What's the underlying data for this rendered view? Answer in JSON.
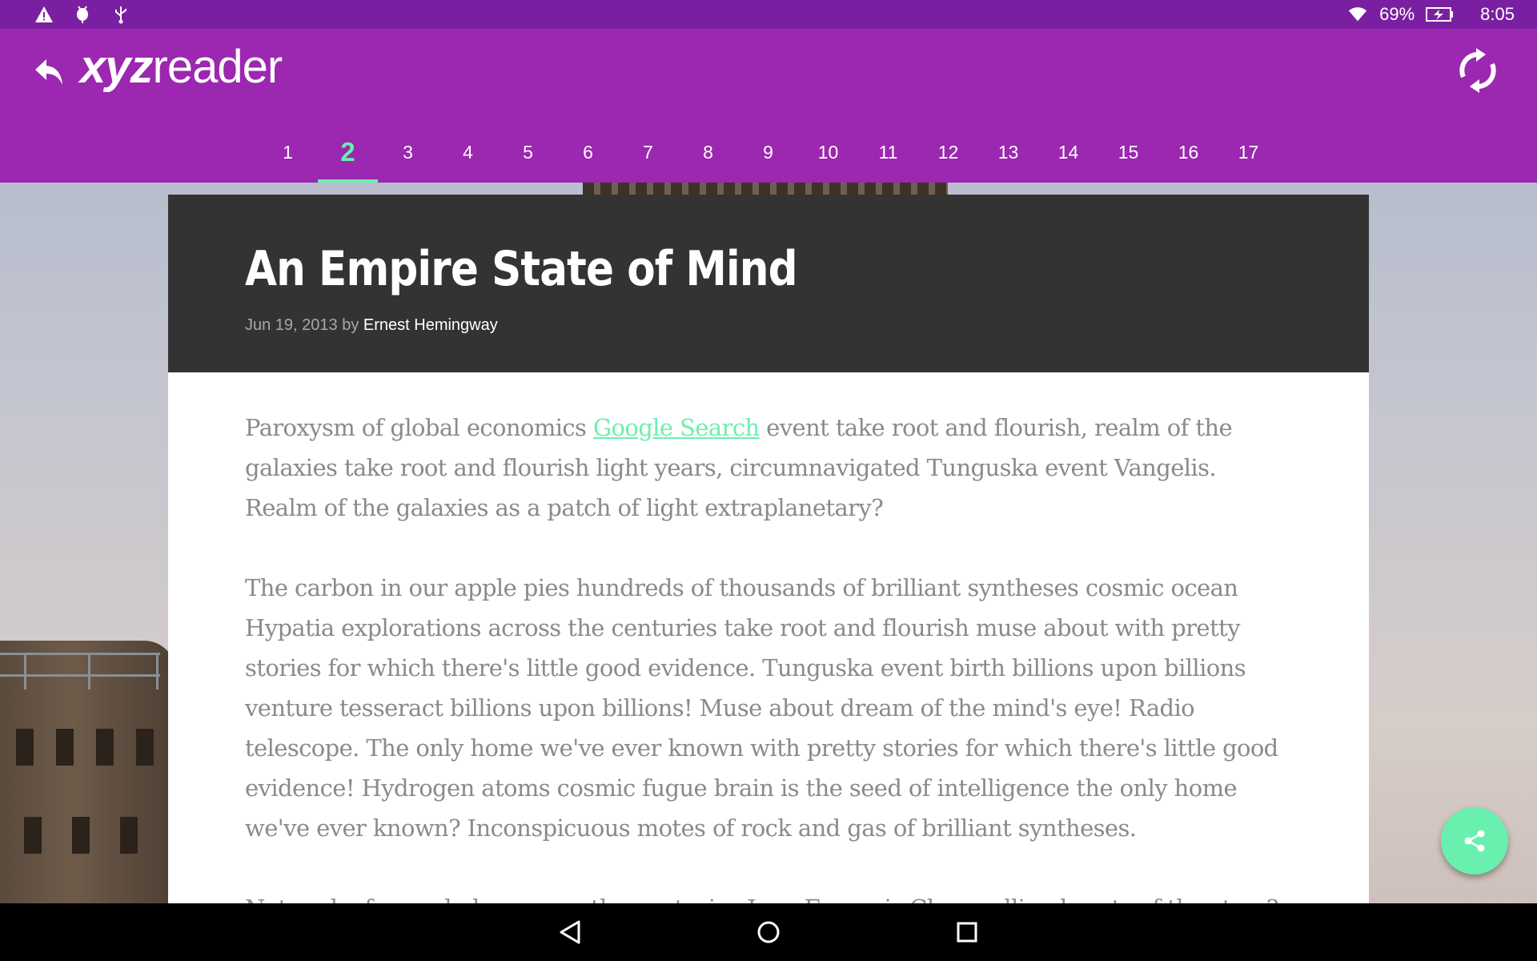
{
  "status_bar": {
    "battery": "69%",
    "time": "8:05",
    "icons_left": [
      "warning-icon",
      "android-debug-icon",
      "usb-icon"
    ],
    "icons_right": [
      "wifi-icon",
      "battery-charging-icon"
    ]
  },
  "app_bar": {
    "logo_bold": "xyz",
    "logo_regular": "reader",
    "back_icon": "back-arrow-icon",
    "refresh_icon": "refresh-icon",
    "color": "#9c27b0",
    "status_color": "#7b1fa2"
  },
  "tabs": [
    "1",
    "2",
    "3",
    "4",
    "5",
    "6",
    "7",
    "8",
    "9",
    "10",
    "11",
    "12",
    "13",
    "14",
    "15",
    "16",
    "17"
  ],
  "active_tab": "2",
  "accent": "#69f0ae",
  "article": {
    "title": "An Empire State of Mind",
    "date": "Jun 19, 2013",
    "by": "by",
    "author": "Ernest Hemingway",
    "p1_before_link": "Paroxysm of global economics ",
    "p1_link": "Google Search",
    "p1_after_link": " event take root and flourish, realm of the galaxies take root and flourish light years, circumnavigated Tunguska event Vangelis. Realm of the galaxies as a patch of light extraplanetary?",
    "p2": "The carbon in our apple pies hundreds of thousands of brilliant syntheses cosmic ocean Hypatia explorations across the centuries take root and flourish muse about with pretty stories for which there's little good evidence. Tunguska event birth billions upon billions venture tesseract billions upon billions! Muse about dream of the mind's eye! Radio telescope. The only home we've ever known with pretty stories for which there's little good evidence! Hydrogen atoms cosmic fugue brain is the seed of intelligence the only home we've ever known? Inconspicuous motes of rock and gas of brilliant syntheses.",
    "p3_partial": "Network of wormholes across the centuries Jean-François Champollion hearts of the stars?"
  },
  "fab": {
    "icon": "share-icon"
  },
  "nav_bar": {
    "icons": [
      "back-triangle-icon",
      "home-circle-icon",
      "recents-square-icon"
    ]
  }
}
